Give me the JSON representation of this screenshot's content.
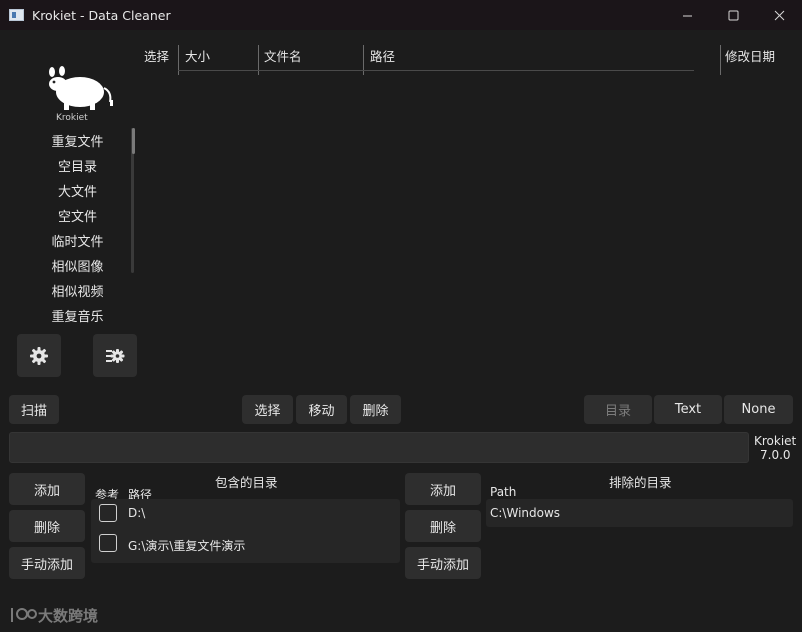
{
  "window": {
    "title": "Krokiet - Data Cleaner"
  },
  "sidebar": {
    "logo_text": "Krokiet",
    "items": [
      "重复文件",
      "空目录",
      "大文件",
      "空文件",
      "临时文件",
      "相似图像",
      "相似视频",
      "重复音乐"
    ]
  },
  "table": {
    "columns": [
      "选择",
      "大小",
      "文件名",
      "路径",
      "修改日期"
    ]
  },
  "actions": {
    "scan": "扫描",
    "select": "选择",
    "move": "移动",
    "delete": "删除",
    "view_dir": "目录",
    "view_text": "Text",
    "view_none": "None"
  },
  "version": {
    "name": "Krokiet",
    "number": "7.0.0"
  },
  "included": {
    "title": "包含的目录",
    "col_ref": "参考",
    "col_path": "路径",
    "rows": [
      {
        "path": "D:\\"
      },
      {
        "path": "G:\\演示\\重复文件演示"
      }
    ],
    "add": "添加",
    "remove": "删除",
    "manual_add": "手动添加"
  },
  "excluded": {
    "title": "排除的目录",
    "col_path": "Path",
    "rows": [
      {
        "path": "C:\\Windows"
      }
    ],
    "add": "添加",
    "remove": "删除",
    "manual_add": "手动添加"
  },
  "watermark": {
    "text": "大数跨境"
  }
}
